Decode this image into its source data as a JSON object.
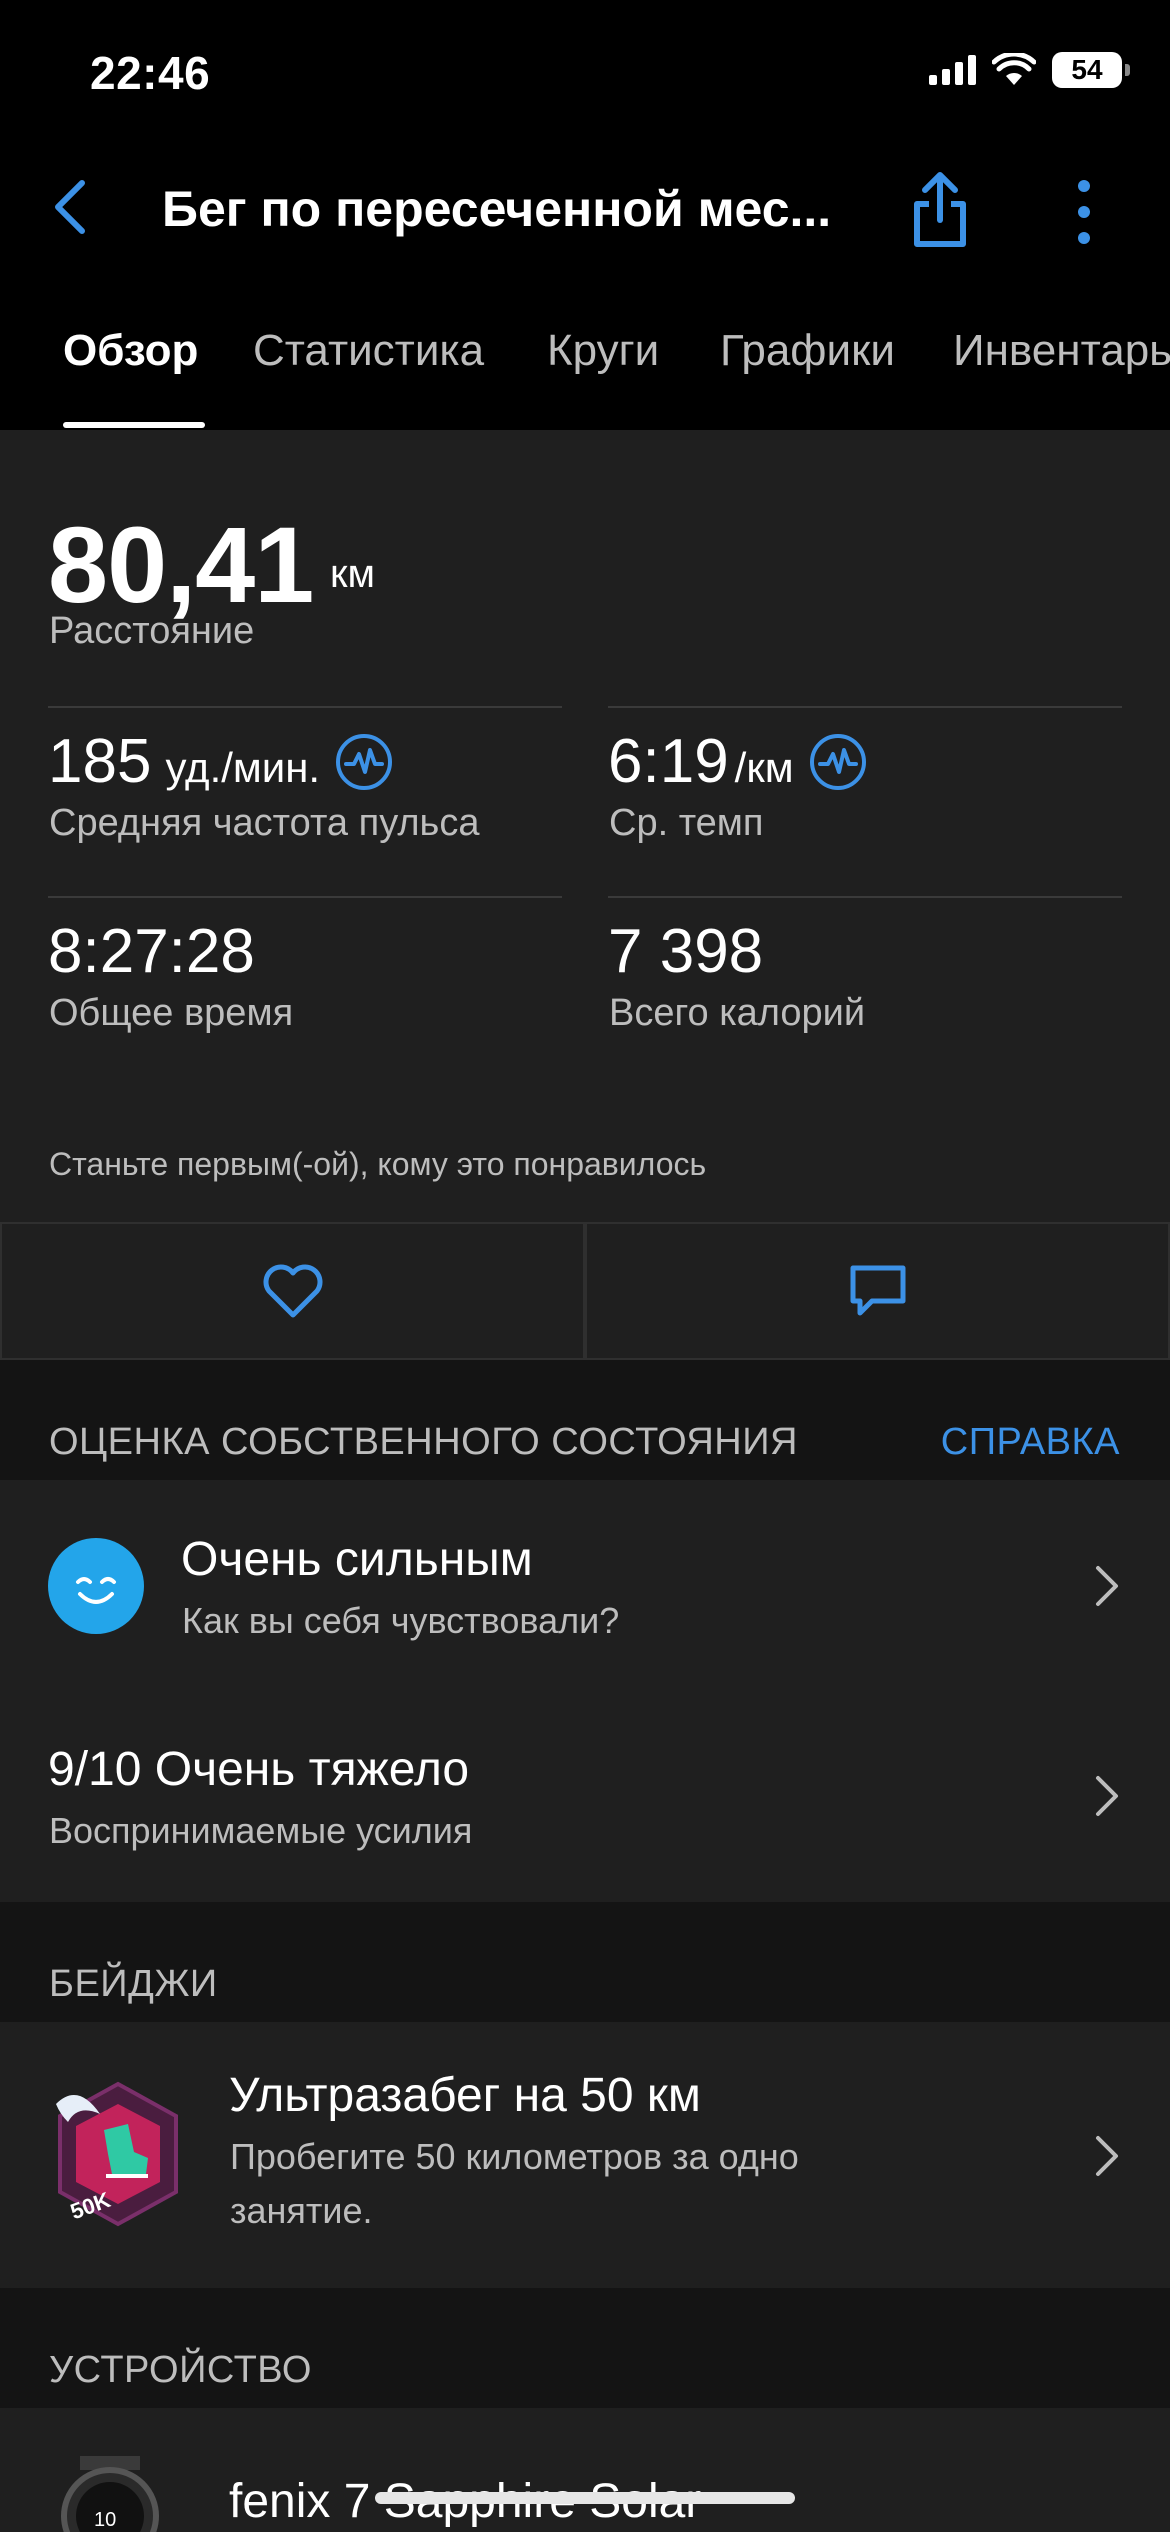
{
  "status_bar": {
    "time": "22:46",
    "battery": "54"
  },
  "header": {
    "title": "Бег по пересеченной мес..."
  },
  "tabs": [
    {
      "label": "Обзор"
    },
    {
      "label": "Статистика"
    },
    {
      "label": "Круги"
    },
    {
      "label": "Графики"
    },
    {
      "label": "Инвентарь"
    }
  ],
  "overview": {
    "distance": {
      "value": "80,41",
      "unit": "км",
      "label": "Расстояние"
    },
    "heart_rate": {
      "value": "185",
      "unit": "уд./мин.",
      "label": "Средняя частота пульса"
    },
    "pace": {
      "value": "6:19",
      "unit": "/км",
      "label": "Ср. темп"
    },
    "total_time": {
      "value": "8:27:28",
      "label": "Общее время"
    },
    "calories": {
      "value": "7 398",
      "label": "Всего калорий"
    },
    "likes_text": "Станьте первым(-ой), кому это понравилось"
  },
  "self_eval": {
    "section_title": "ОЦЕНКА СОБСТВЕННОГО СОСТОЯНИЯ",
    "help_link": "СПРАВКА",
    "feeling": {
      "title": "Очень сильным",
      "subtitle": "Как вы себя чувствовали?"
    },
    "effort": {
      "title": "9/10 Очень тяжело",
      "subtitle": "Воспринимаемые усилия"
    }
  },
  "badges": {
    "section_title": "БЕЙДЖИ",
    "item": {
      "title": "Ультразабег на 50 км",
      "subtitle_line1": "Пробегите 50 километров за одно",
      "subtitle_line2": "занятие.",
      "badge_text": "50K"
    }
  },
  "device": {
    "section_title": "УСТРОЙСТВО",
    "name": "fenix 7 Sapphire Solar"
  },
  "colors": {
    "accent": "#3c91e6",
    "card": "#1f1f1f",
    "background": "#141414"
  }
}
